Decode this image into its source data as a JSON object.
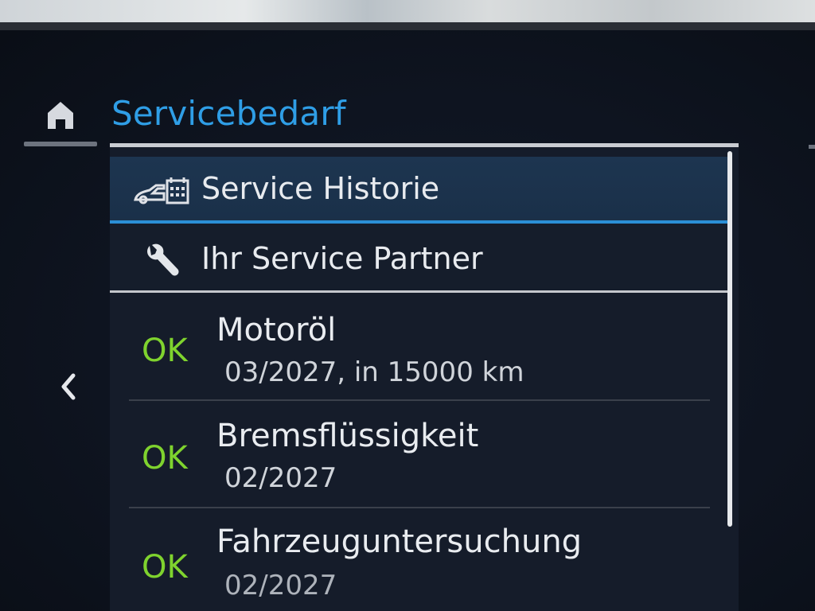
{
  "header": {
    "home_icon": "home-icon",
    "title": "Servicebedarf"
  },
  "menu": {
    "service_history": {
      "label": "Service Historie",
      "icon": "car-calendar-icon"
    },
    "service_partner": {
      "label": "Ihr Service Partner",
      "icon": "wrench-icon"
    }
  },
  "services": [
    {
      "status": "OK",
      "name": "Motoröl",
      "detail": "03/2027, in 15000 km"
    },
    {
      "status": "OK",
      "name": "Bremsflüssigkeit",
      "detail": "02/2027"
    },
    {
      "status": "OK",
      "name": "Fahrzeuguntersuchung",
      "detail": "02/2027"
    }
  ],
  "nav": {
    "back_icon": "chevron-left-icon"
  },
  "colors": {
    "accent": "#2f9ee6",
    "ok": "#7fd32e",
    "text": "#e8ebef"
  }
}
